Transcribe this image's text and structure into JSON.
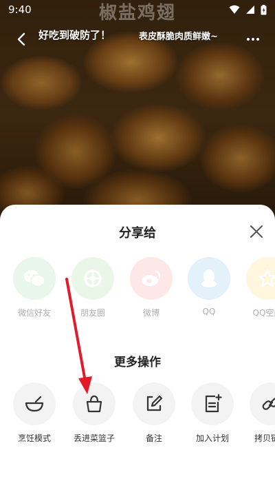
{
  "status_bar": {
    "time": "9:40"
  },
  "video": {
    "title": "椒盐鸡翅",
    "subtitle_left": "好吃到破防了！",
    "subtitle_right": "表皮酥脆肉质鲜嫩~"
  },
  "share_sheet": {
    "title": "分享给",
    "targets": [
      {
        "label": "微信好友",
        "icon": "wechat-icon",
        "color": "#e8f6ec"
      },
      {
        "label": "朋友圈",
        "icon": "moments-icon",
        "color": "#eaf7e8"
      },
      {
        "label": "微博",
        "icon": "weibo-icon",
        "color": "#fde7e7"
      },
      {
        "label": "QQ",
        "icon": "qq-icon",
        "color": "#e3f1fb"
      },
      {
        "label": "QQ空间",
        "icon": "qzone-icon",
        "color": "#fff6de"
      }
    ],
    "more_title": "更多操作",
    "actions": [
      {
        "label": "烹饪模式",
        "icon": "bowl-icon"
      },
      {
        "label": "丢进菜篮子",
        "icon": "basket-icon"
      },
      {
        "label": "备注",
        "icon": "edit-icon"
      },
      {
        "label": "加入计划",
        "icon": "plan-icon"
      },
      {
        "label": "拷贝链接",
        "icon": "link-icon"
      }
    ]
  },
  "annotation": {
    "color": "#e21b2a"
  }
}
